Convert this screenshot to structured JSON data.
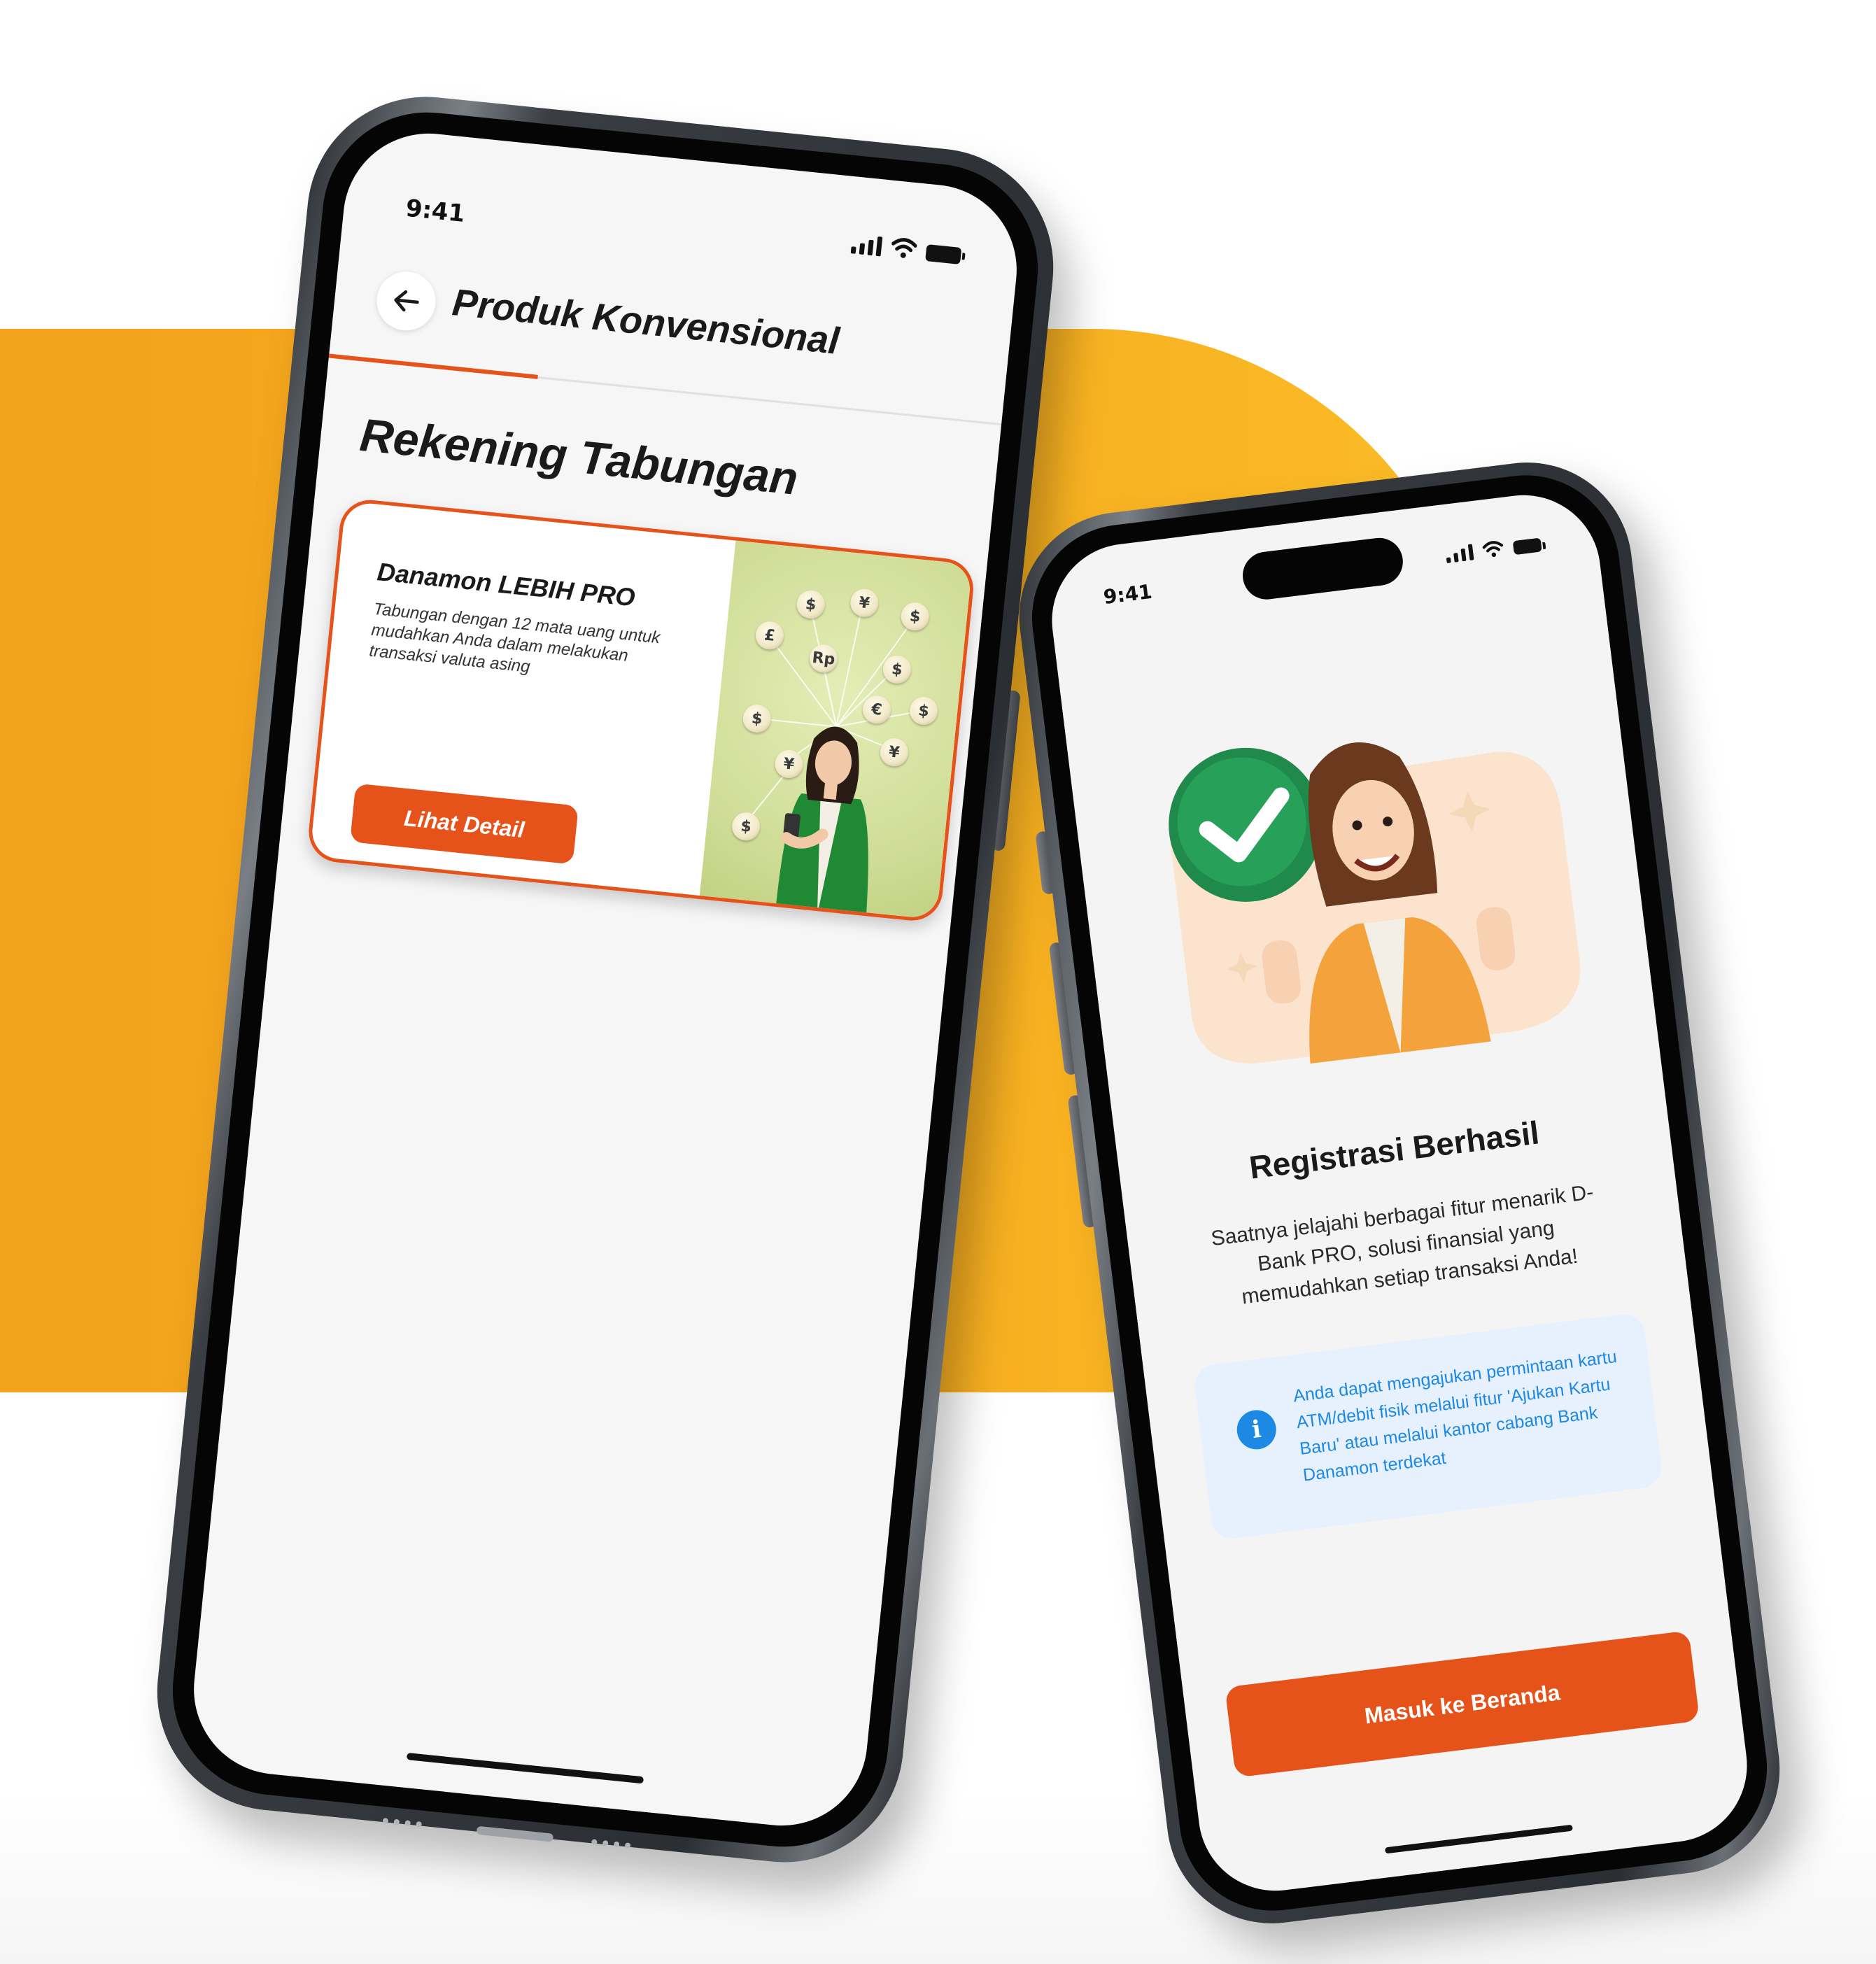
{
  "phone1": {
    "status": {
      "time": "9:41"
    },
    "header": {
      "title": "Produk Konvensional",
      "back_icon": "arrow-left-icon"
    },
    "section_title": "Rekening Tabungan",
    "card": {
      "name": "Danamon LEBIH PRO",
      "description": "Tabungan dengan 12 mata uang untuk mudahkan Anda dalam melakukan transaksi valuta asing",
      "button_label": "Lihat Detail",
      "coins": [
        "$",
        "$",
        "¥",
        "£",
        "Rp",
        "$",
        "€",
        "$",
        "$",
        "¥",
        "¥",
        "$"
      ]
    }
  },
  "phone2": {
    "status": {
      "time": "9:41"
    },
    "title": "Registrasi Berhasil",
    "description": "Saatnya jelajahi berbagai fitur menarik D-Bank PRO, solusi finansial yang memudahkan setiap transaksi Anda!",
    "info": {
      "icon": "info-icon",
      "text": "Anda dapat mengajukan permintaan kartu ATM/debit fisik melalui fitur 'Ajukan Kartu Baru' atau melalui kantor cabang Bank Danamon terdekat"
    },
    "button_label": "Masuk ke Beranda"
  },
  "colors": {
    "accent": "#e6531a",
    "background_band": "#f6ab1f",
    "info_blue": "#1e88e5",
    "info_bg": "#e7f1fd"
  }
}
